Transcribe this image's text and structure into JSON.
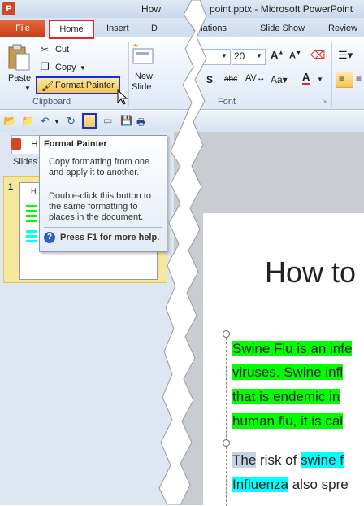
{
  "window": {
    "title_left": "How",
    "title_right": "point.pptx - Microsoft PowerPoint",
    "app_icon": "P"
  },
  "tabs": {
    "file": "File",
    "home": "Home",
    "insert": "Insert",
    "design_partial": "D",
    "animations_partial": "imations",
    "slide_show": "Slide Show",
    "review": "Review"
  },
  "ribbon": {
    "clipboard": {
      "paste": "Paste",
      "cut": "Cut",
      "copy": "Copy",
      "format_painter": "Format Painter",
      "group_label": "Clipboard"
    },
    "slides": {
      "new_slide_line1": "New",
      "new_slide_line2": "Slide"
    },
    "font": {
      "size": "20",
      "group_label": "Font"
    }
  },
  "left_pane": {
    "doc_tab_partial": "H",
    "slides_label": "Slides",
    "thumb_number": "1",
    "thumb_title": "H"
  },
  "tooltip": {
    "title": "Format Painter",
    "body1": "Copy formatting from one and apply it to another.",
    "body2": "Double-click this button to the same formatting to places in the document.",
    "help": "Press F1 for more help."
  },
  "slide": {
    "title": "How to",
    "lines": [
      "Swine Flu is an infe",
      "viruses. Swine infl",
      "that is endemic in",
      "human flu, it is cal"
    ],
    "para2_line1": [
      "The",
      " risk of ",
      "swine f"
    ],
    "para2_line2": [
      "Influenza",
      " also spre"
    ]
  },
  "colors": {
    "highlight_green": "#00ff00",
    "highlight_cyan": "#00ffff",
    "callout_red": "#e0262b",
    "callout_blue": "#1a2fd0"
  }
}
